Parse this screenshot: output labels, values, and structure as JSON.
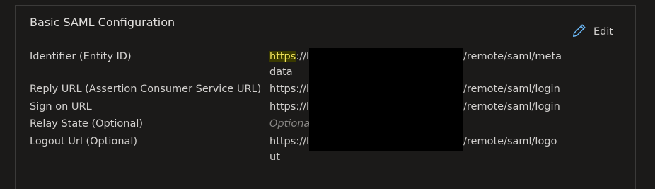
{
  "section": {
    "title": "Basic SAML Configuration",
    "edit_label": "Edit",
    "edit_icon": "pencil-icon"
  },
  "fields": {
    "identifier": {
      "label": "Identifier (Entity ID)",
      "value_prefix": "https",
      "value_rest_line1": "://l",
      "value_suffix_line1": "/remote/saml/meta",
      "value_line2": "data"
    },
    "reply_url": {
      "label": "Reply URL (Assertion Consumer Service URL)",
      "value": "https://l",
      "value_suffix": "/remote/saml/login"
    },
    "sign_on_url": {
      "label": "Sign on URL",
      "value": "https://l",
      "value_suffix": "/remote/saml/login"
    },
    "relay_state": {
      "label": "Relay State (Optional)",
      "value": "Optiona"
    },
    "logout_url": {
      "label": "Logout Url (Optional)",
      "value": "https://l",
      "value_suffix": "/remote/saml/logo",
      "value_line2": "ut"
    }
  },
  "colors": {
    "background": "#1b1a19",
    "border": "#3b3a39",
    "text": "#d2d0ce",
    "accent_icon": "#6cb8f6",
    "highlight_text": "#f3e45a"
  }
}
